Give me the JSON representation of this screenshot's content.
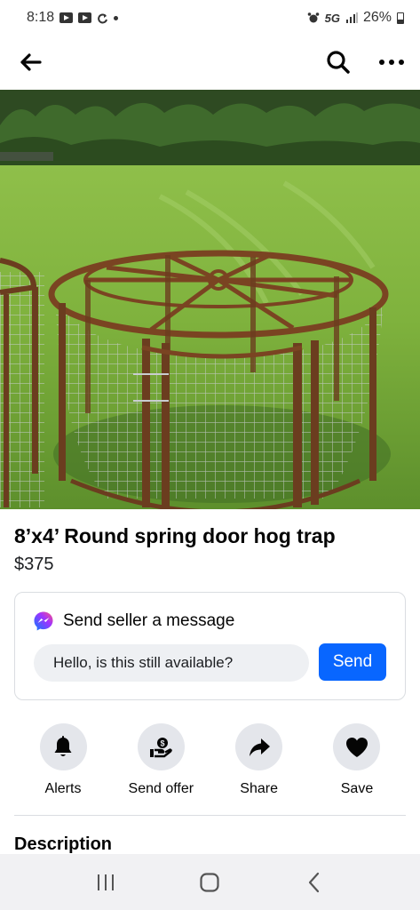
{
  "status_bar": {
    "time": "8:18",
    "network": "5G",
    "battery": "26%"
  },
  "listing": {
    "title": "8’x4’ Round spring door hog trap",
    "price": "$375",
    "photo_index": 1,
    "photo_count": 2
  },
  "message": {
    "heading": "Send seller a message",
    "input_value": "Hello, is this still available?",
    "send_label": "Send"
  },
  "actions": [
    {
      "label": "Alerts",
      "icon": "bell-icon"
    },
    {
      "label": "Send offer",
      "icon": "offer-icon"
    },
    {
      "label": "Share",
      "icon": "share-icon"
    },
    {
      "label": "Save",
      "icon": "heart-icon"
    }
  ],
  "description": {
    "heading": "Description"
  },
  "colors": {
    "accent": "#0866ff",
    "action_circle": "#e4e6eb",
    "input_bg": "#eef0f3"
  }
}
